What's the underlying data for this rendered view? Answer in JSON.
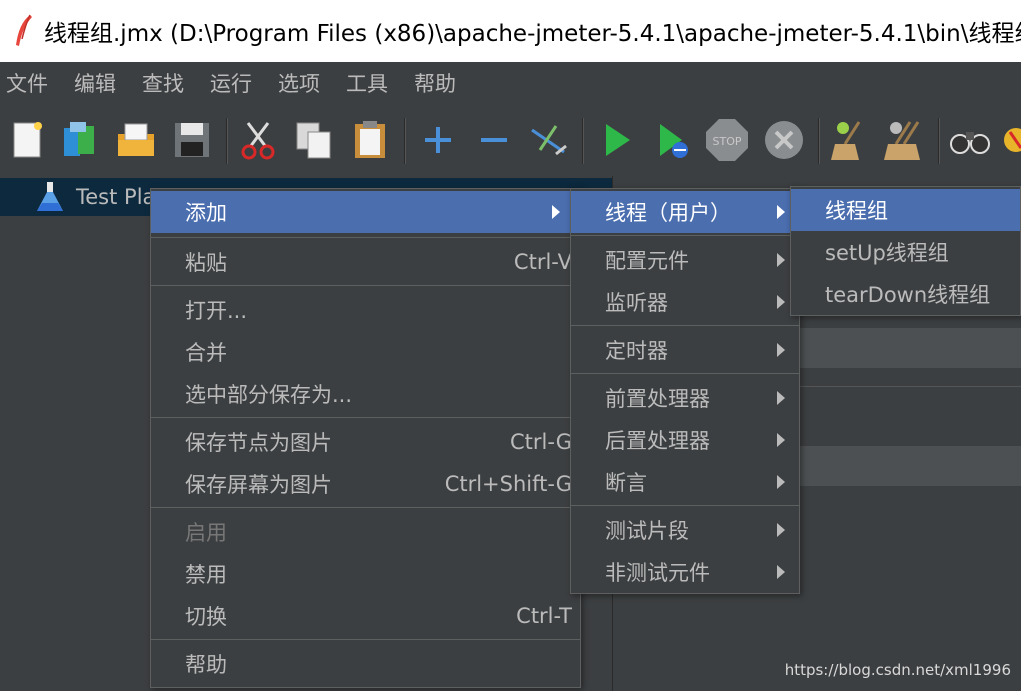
{
  "window": {
    "title": "线程组.jmx (D:\\Program Files (x86)\\apache-jmeter-5.4.1\\apache-jmeter-5.4.1\\bin\\线程组"
  },
  "menubar": [
    "文件",
    "编辑",
    "查找",
    "运行",
    "选项",
    "工具",
    "帮助"
  ],
  "toolbar_icons": [
    "new-icon",
    "templates-icon",
    "open-icon",
    "save-icon",
    "cut-icon",
    "copy-icon",
    "paste-icon",
    "expand-icon",
    "collapse-icon",
    "toggle-icon",
    "start-icon",
    "start-no-pause-icon",
    "stop-icon",
    "shutdown-icon",
    "clear-icon",
    "clear-all-icon",
    "search-icon",
    "reset-search-icon"
  ],
  "tree": {
    "node_label": "Test Pla"
  },
  "context_menu": {
    "add": "添加",
    "paste": "粘贴",
    "paste_acc": "Ctrl-V",
    "open": "打开...",
    "merge": "合并",
    "save_selection": "选中部分保存为...",
    "save_node_image": "保存节点为图片",
    "save_node_image_acc": "Ctrl-G",
    "save_screen_image": "保存屏幕为图片",
    "save_screen_image_acc": "Ctrl+Shift-G",
    "enable": "启用",
    "disable": "禁用",
    "toggle": "切换",
    "toggle_acc": "Ctrl-T",
    "help": "帮助"
  },
  "add_submenu": {
    "threads": "线程（用户）",
    "config": "配置元件",
    "listener": "监听器",
    "timer": "定时器",
    "pre": "前置处理器",
    "post": "后置处理器",
    "assertion": "断言",
    "fragment": "测试片段",
    "non_test": "非测试元件"
  },
  "threads_submenu": {
    "thread_group": "线程组",
    "setup": "setUp线程组",
    "teardown": "tearDown线程组"
  },
  "watermark": "https://blog.csdn.net/xml1996",
  "colors": {
    "selection": "#4b6eaf",
    "background": "#3c3f41",
    "text": "#bbbbbb"
  }
}
